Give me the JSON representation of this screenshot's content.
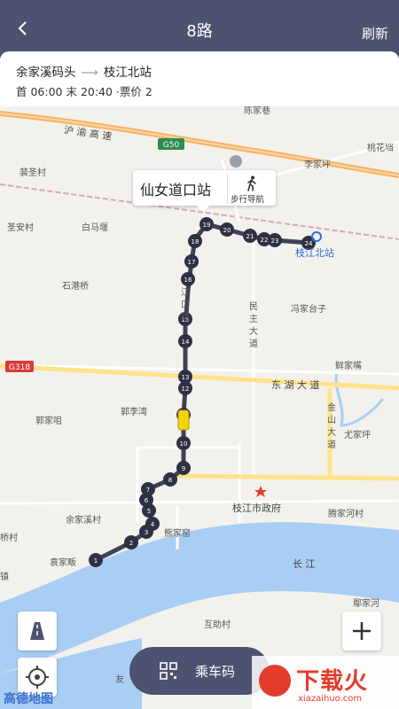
{
  "header": {
    "title": "8路",
    "refresh_label": "刷新"
  },
  "route": {
    "origin": "余家溪码头",
    "destination": "枝江北站",
    "schedule": "首 06:00 末 20:40 ·票价 2"
  },
  "callout": {
    "station_name": "仙女道口站",
    "walk_label": "步行导航"
  },
  "map": {
    "highway_label": "沪 渝 高 速",
    "shields": {
      "g50": "G50",
      "g318": "G318"
    },
    "places": {
      "tanjiawan": "陈家巷",
      "taohuazhen": "桃花垱",
      "lijiaping": "李家坪",
      "peishengcun": "裴圣村",
      "shenganchun": "圣安村",
      "baimayan": "白马堰",
      "shigangqiao": "石港桥",
      "fengjiataizi": "冯家台子",
      "xianjiawan": "鲜家嘴",
      "guojiajing": "郭家咀",
      "guolivan": "郭李湾",
      "youjiaping": "尤家坪",
      "yujiaxi": "余家溪村",
      "government": "枝江市政府",
      "tengjiahecun": "腾家河村",
      "xiongjiawo": "熊家窑",
      "yuanjiafan": "袁家畈",
      "qiaocun": "桥村",
      "zhen": "镇",
      "zhangjiang": "长 江",
      "ejiahe": "鄢家河",
      "huzhucun": "互助村",
      "you": "友"
    },
    "roads": {
      "donghu": "东 湖 大 道",
      "minzhu": "民主大道",
      "jinshan": "金山大道",
      "jiangkou": "江口路"
    },
    "destination_station": "枝江北站",
    "stops": [
      "1",
      "2",
      "3",
      "4",
      "5",
      "6",
      "7",
      "8",
      "9",
      "10",
      "11",
      "12",
      "13",
      "14",
      "15",
      "16",
      "17",
      "18",
      "19",
      "20",
      "21",
      "22",
      "23",
      "24"
    ]
  },
  "controls": {
    "traffic": "road-icon",
    "locate": "locate-icon",
    "zoom_in": "plus-icon"
  },
  "qr_button": {
    "label": "乘车码"
  },
  "branding": {
    "map_provider": "高德地图"
  },
  "watermark": {
    "name": "下载火",
    "url": "xiazaihuo.com"
  },
  "colors": {
    "header": "#4d5270",
    "route_line": "#3e4256",
    "stop_dot": "#2e3142",
    "bus": "#f5d20a",
    "water": "#a9cef4",
    "road_major": "#fce38a"
  }
}
